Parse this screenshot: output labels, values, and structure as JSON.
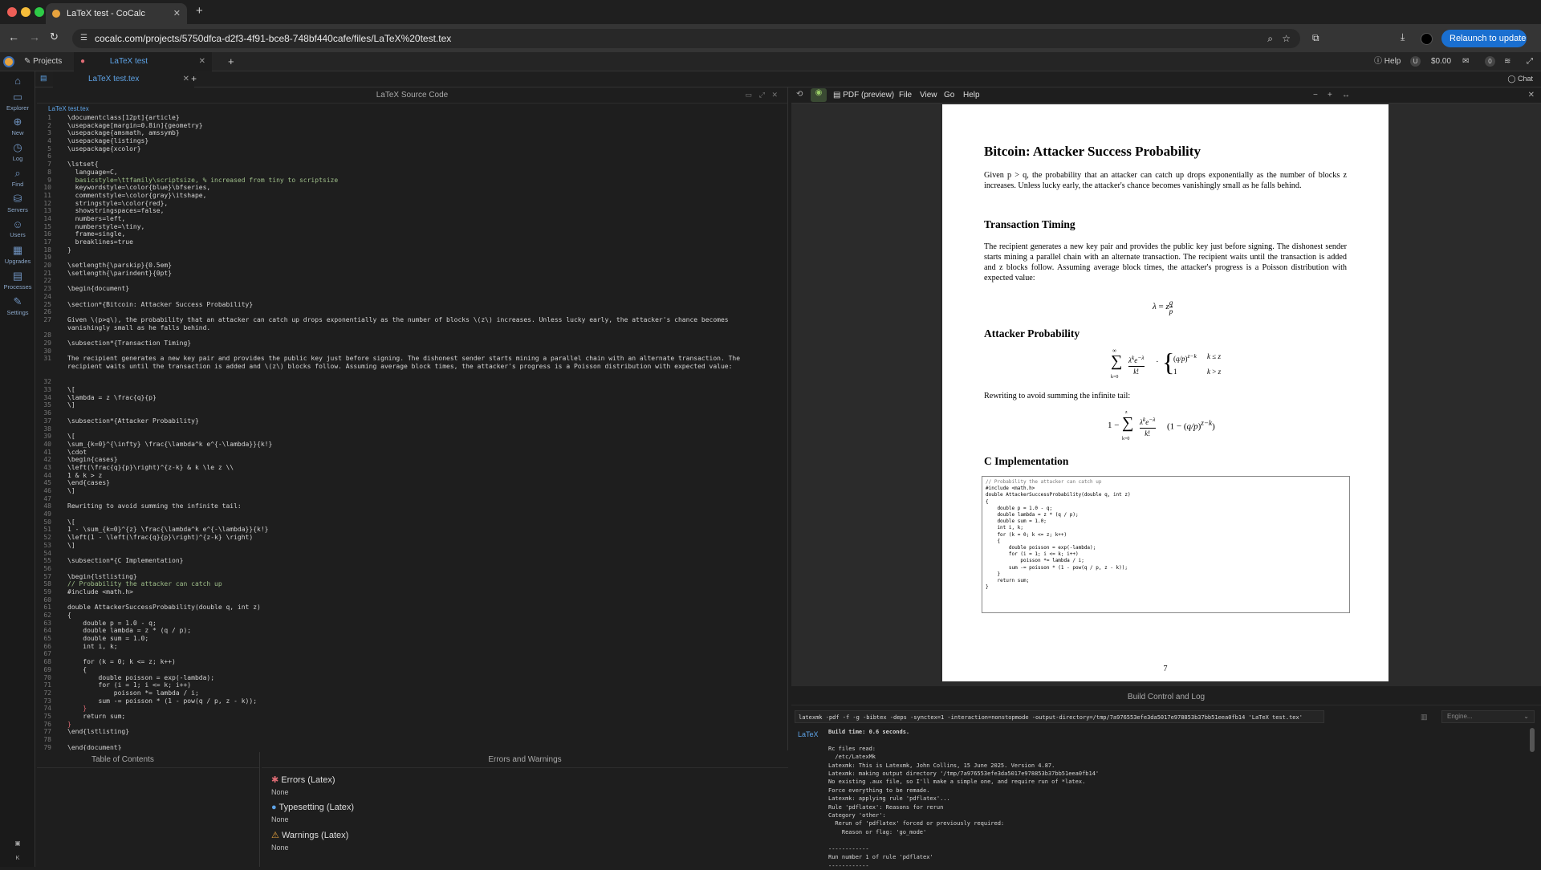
{
  "browser": {
    "tab_title": "LaTeX test - CoCalc",
    "url": "cocalc.com/projects/5750dfca-d2f3-4f91-bce8-748bf440cafe/files/LaTeX%20test.tex",
    "relaunch": "Relaunch to update"
  },
  "app": {
    "projects_tab": "Projects",
    "project_tab": "LaTeX test",
    "help": "Help",
    "balance": "$0.00",
    "notif_count": "0",
    "chat": "Chat",
    "file_tab": "LaTeX test.tex",
    "breadcrumb": "LaTeX test.tex"
  },
  "sidebar": [
    {
      "label": "Explorer",
      "icon": "folder-icon"
    },
    {
      "label": "New",
      "icon": "plus-circle-icon"
    },
    {
      "label": "Log",
      "icon": "history-icon"
    },
    {
      "label": "Find",
      "icon": "search-icon"
    },
    {
      "label": "Servers",
      "icon": "server-icon"
    },
    {
      "label": "Users",
      "icon": "users-icon"
    },
    {
      "label": "Upgrades",
      "icon": "upgrade-icon"
    },
    {
      "label": "Processes",
      "icon": "processes-icon"
    },
    {
      "label": "Settings",
      "icon": "wrench-icon"
    }
  ],
  "source": {
    "title": "LaTeX Source Code",
    "lines": [
      {
        "n": "1",
        "t": "\\documentclass[12pt]{article}"
      },
      {
        "n": "2",
        "t": "\\usepackage[margin=0.8in]{geometry}"
      },
      {
        "n": "3",
        "t": "\\usepackage{amsmath, amssymb}"
      },
      {
        "n": "4",
        "t": "\\usepackage{listings}"
      },
      {
        "n": "5",
        "t": "\\usepackage{xcolor}"
      },
      {
        "n": "6",
        "t": ""
      },
      {
        "n": "7",
        "t": "\\lstset{"
      },
      {
        "n": "8",
        "t": "  language=C,"
      },
      {
        "n": "9",
        "t": "  basicstyle=\\ttfamily\\scriptsize, % increased from tiny to scriptsize"
      },
      {
        "n": "10",
        "t": "  keywordstyle=\\color{blue}\\bfseries,"
      },
      {
        "n": "11",
        "t": "  commentstyle=\\color{gray}\\itshape,"
      },
      {
        "n": "12",
        "t": "  stringstyle=\\color{red},"
      },
      {
        "n": "13",
        "t": "  showstringspaces=false,"
      },
      {
        "n": "14",
        "t": "  numbers=left,"
      },
      {
        "n": "15",
        "t": "  numberstyle=\\tiny,"
      },
      {
        "n": "16",
        "t": "  frame=single,"
      },
      {
        "n": "17",
        "t": "  breaklines=true"
      },
      {
        "n": "18",
        "t": "}"
      },
      {
        "n": "19",
        "t": ""
      },
      {
        "n": "20",
        "t": "\\setlength{\\parskip}{0.5em}"
      },
      {
        "n": "21",
        "t": "\\setlength{\\parindent}{0pt}"
      },
      {
        "n": "22",
        "t": ""
      },
      {
        "n": "23",
        "t": "\\begin{document}"
      },
      {
        "n": "24",
        "t": ""
      },
      {
        "n": "25",
        "t": "\\section*{Bitcoin: Attacker Success Probability}"
      },
      {
        "n": "26",
        "t": ""
      },
      {
        "n": "27",
        "t": "Given \\(p>q\\), the probability that an attacker can catch up drops exponentially as the number of blocks \\(z\\) increases. Unless lucky early, the attacker's chance becomes"
      },
      {
        "n": "",
        "t": "vanishingly small as he falls behind."
      },
      {
        "n": "28",
        "t": ""
      },
      {
        "n": "29",
        "t": "\\subsection*{Transaction Timing}"
      },
      {
        "n": "30",
        "t": ""
      },
      {
        "n": "31",
        "t": "The recipient generates a new key pair and provides the public key just before signing. The dishonest sender starts mining a parallel chain with an alternate transaction. The"
      },
      {
        "n": "",
        "t": "recipient waits until the transaction is added and \\(z\\) blocks follow. Assuming average block times, the attacker's progress is a Poisson distribution with expected value:"
      },
      {
        "n": "",
        "t": ""
      },
      {
        "n": "32",
        "t": ""
      },
      {
        "n": "33",
        "t": "\\["
      },
      {
        "n": "34",
        "t": "\\lambda = z \\frac{q}{p}"
      },
      {
        "n": "35",
        "t": "\\]"
      },
      {
        "n": "36",
        "t": ""
      },
      {
        "n": "37",
        "t": "\\subsection*{Attacker Probability}"
      },
      {
        "n": "38",
        "t": ""
      },
      {
        "n": "39",
        "t": "\\["
      },
      {
        "n": "40",
        "t": "\\sum_{k=0}^{\\infty} \\frac{\\lambda^k e^{-\\lambda}}{k!}"
      },
      {
        "n": "41",
        "t": "\\cdot"
      },
      {
        "n": "42",
        "t": "\\begin{cases}"
      },
      {
        "n": "43",
        "t": "\\left(\\frac{q}{p}\\right)^{z-k} & k \\le z \\\\"
      },
      {
        "n": "44",
        "t": "1 & k > z"
      },
      {
        "n": "45",
        "t": "\\end{cases}"
      },
      {
        "n": "46",
        "t": "\\]"
      },
      {
        "n": "47",
        "t": ""
      },
      {
        "n": "48",
        "t": "Rewriting to avoid summing the infinite tail:"
      },
      {
        "n": "49",
        "t": ""
      },
      {
        "n": "50",
        "t": "\\["
      },
      {
        "n": "51",
        "t": "1 - \\sum_{k=0}^{z} \\frac{\\lambda^k e^{-\\lambda}}{k!}"
      },
      {
        "n": "52",
        "t": "\\left(1 - \\left(\\frac{q}{p}\\right)^{z-k} \\right)"
      },
      {
        "n": "53",
        "t": "\\]"
      },
      {
        "n": "54",
        "t": ""
      },
      {
        "n": "55",
        "t": "\\subsection*{C Implementation}"
      },
      {
        "n": "56",
        "t": ""
      },
      {
        "n": "57",
        "t": "\\begin{lstlisting}"
      },
      {
        "n": "58",
        "t": "// Probability the attacker can catch up"
      },
      {
        "n": "59",
        "t": "#include <math.h>"
      },
      {
        "n": "60",
        "t": ""
      },
      {
        "n": "61",
        "t": "double AttackerSuccessProbability(double q, int z)"
      },
      {
        "n": "62",
        "t": "{"
      },
      {
        "n": "63",
        "t": "    double p = 1.0 - q;"
      },
      {
        "n": "64",
        "t": "    double lambda = z * (q / p);"
      },
      {
        "n": "65",
        "t": "    double sum = 1.0;"
      },
      {
        "n": "66",
        "t": "    int i, k;"
      },
      {
        "n": "67",
        "t": ""
      },
      {
        "n": "68",
        "t": "    for (k = 0; k <= z; k++)"
      },
      {
        "n": "69",
        "t": "    {"
      },
      {
        "n": "70",
        "t": "        double poisson = exp(-lambda);"
      },
      {
        "n": "71",
        "t": "        for (i = 1; i <= k; i++)"
      },
      {
        "n": "72",
        "t": "            poisson *= lambda / i;"
      },
      {
        "n": "73",
        "t": "        sum -= poisson * (1 - pow(q / p, z - k));"
      },
      {
        "n": "74",
        "t": "    }"
      },
      {
        "n": "75",
        "t": "    return sum;"
      },
      {
        "n": "76",
        "t": "}"
      },
      {
        "n": "77",
        "t": "\\end{lstlisting}"
      },
      {
        "n": "78",
        "t": ""
      },
      {
        "n": "79",
        "t": "\\end{document}"
      }
    ]
  },
  "toc": {
    "title": "Table of Contents"
  },
  "errors": {
    "title": "Errors and Warnings",
    "errors_head": "Errors (Latex)",
    "errors_val": "None",
    "typeset_head": "Typesetting (Latex)",
    "typeset_val": "None",
    "warn_head": "Warnings (Latex)",
    "warn_val": "None"
  },
  "pdf": {
    "label": "PDF (preview)",
    "menu": [
      "File",
      "View",
      "Go",
      "Help"
    ],
    "title": "Bitcoin:  Attacker Success Probability",
    "p1": "Given p > q, the probability that an attacker can catch up drops exponentially as the number of blocks z increases. Unless lucky early, the attacker's chance becomes vanishingly small as he falls behind.",
    "h_timing": "Transaction Timing",
    "p2": "The recipient generates a new key pair and provides the public key just before signing.  The dishonest sender starts mining a parallel chain with an alternate transaction. The recipient waits until the transaction is added and z blocks follow.  Assuming average block times, the attacker's progress is a Poisson distribution with expected value:",
    "h_prob": "Attacker Probability",
    "p3": "Rewriting to avoid summing the infinite tail:",
    "h_impl": "C Implementation",
    "page_number": "7",
    "code_lines": [
      "// Probability the attacker can catch up",
      "#include <math.h>",
      "",
      "double AttackerSuccessProbability(double q, int z)",
      "{",
      "    double p = 1.0 - q;",
      "    double lambda = z * (q / p);",
      "    double sum = 1.0;",
      "    int i, k;",
      "",
      "    for (k = 0; k <= z; k++)",
      "    {",
      "        double poisson = exp(-lambda);",
      "        for (i = 1; i <= k; i++)",
      "            poisson *= lambda / i;",
      "        sum -= poisson * (1 - pow(q / p, z - k));",
      "    }",
      "    return sum;",
      "}"
    ]
  },
  "build": {
    "title": "Build Control and Log",
    "command": "latexmk -pdf -f -g -bibtex -deps -synctex=1 -interaction=nonstopmode -output-directory=/tmp/7a976553efe3da5017e978853b37bb51eea0fb14 'LaTeX test.tex'",
    "engine_placeholder": "Engine...",
    "latex_tab": "LaTeX",
    "log": [
      "Build time: 0.6 seconds.",
      "",
      "Rc files read:",
      "  /etc/LatexMk",
      "Latexmk: This is Latexmk, John Collins, 15 June 2025. Version 4.87.",
      "Latexmk: making output directory '/tmp/7a976553efe3da5017e978853b37bb51eea0fb14'",
      "No existing .aux file, so I'll make a simple one, and require run of *latex.",
      "Force everything to be remade.",
      "Latexmk: applying rule 'pdflatex'...",
      "Rule 'pdflatex': Reasons for rerun",
      "Category 'other':",
      "  Rerun of 'pdflatex' forced or previously required:",
      "    Reason or flag: 'go_mode'",
      "",
      "------------",
      "Run number 1 of rule 'pdflatex'",
      "------------"
    ]
  }
}
